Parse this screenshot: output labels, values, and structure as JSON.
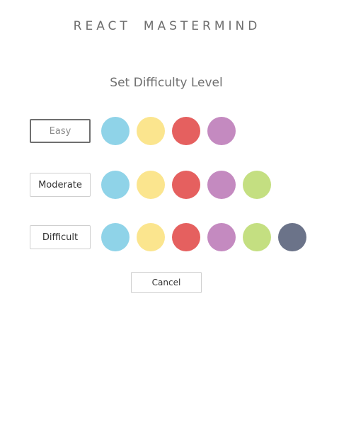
{
  "header": {
    "title_words": [
      "REACT",
      "MASTERMIND"
    ]
  },
  "settings": {
    "heading": "Set Difficulty Level",
    "levels": [
      {
        "label": "Easy",
        "selected": true,
        "colors": [
          "#8fd3e8",
          "#fbe58e",
          "#e5605f",
          "#c48ac0"
        ]
      },
      {
        "label": "Moderate",
        "selected": false,
        "colors": [
          "#8fd3e8",
          "#fbe58e",
          "#e5605f",
          "#c48ac0",
          "#c4df81"
        ]
      },
      {
        "label": "Difficult",
        "selected": false,
        "colors": [
          "#8fd3e8",
          "#fbe58e",
          "#e5605f",
          "#c48ac0",
          "#c4df81",
          "#6b7389"
        ]
      }
    ],
    "cancel_label": "Cancel"
  }
}
